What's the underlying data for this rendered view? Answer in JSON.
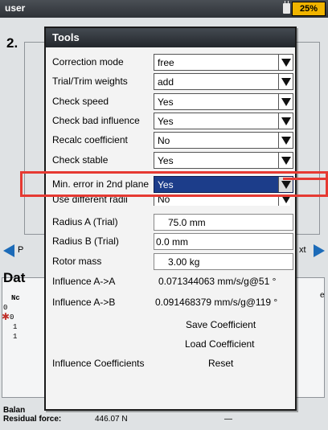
{
  "topbar": {
    "user": "user",
    "battery": "25%"
  },
  "background": {
    "title_fragment": "2. ",
    "prev_fragment": "P",
    "next_fragment": "xt",
    "data_fragment": "Dat",
    "rows_fragment": [
      "Nc",
      "0",
      "0",
      "1",
      "1"
    ],
    "edge_fragment": "e",
    "footer": {
      "balance_label": "Balan",
      "residual_label": "Residual force:",
      "residual_value": "446.07 N",
      "dash": "—"
    }
  },
  "dialog": {
    "title": "Tools",
    "fields": [
      {
        "label": "Correction mode",
        "value": "free",
        "type": "select"
      },
      {
        "label": "Trial/Trim weights",
        "value": "add",
        "type": "select"
      },
      {
        "label": "Check speed",
        "value": "Yes",
        "type": "select"
      },
      {
        "label": "Check bad influence",
        "value": "Yes",
        "type": "select"
      },
      {
        "label": "Recalc coefficient",
        "value": "No",
        "type": "select"
      },
      {
        "label": "Check stable",
        "value": "Yes",
        "type": "select"
      },
      {
        "label": "Min. error in 2nd plane",
        "value": "Yes",
        "type": "select",
        "highlighted": true
      },
      {
        "label": "Use different radii",
        "value": "No",
        "type": "select"
      },
      {
        "label": "Radius A (Trial)",
        "value": "75.0 mm",
        "type": "number"
      },
      {
        "label": "Radius B (Trial)",
        "value": "0.0 mm",
        "type": "number"
      },
      {
        "label": "Rotor mass",
        "value": "3.00 kg",
        "type": "number"
      }
    ],
    "influence": [
      {
        "label": "Influence A->A",
        "value": "0.071344063 mm/s/g@51 °"
      },
      {
        "label": "Influence A->B",
        "value": "0.091468379 mm/s/g@119 °"
      }
    ],
    "save_label": "Save Coefficient",
    "load_label": "Load Coefficient",
    "coefficients_label": "Influence Coefficients",
    "reset_label": "Reset"
  },
  "colors": {
    "highlight": "#1c3d8a",
    "annotation": "#e63a32",
    "nav_arrow": "#1c6bb8",
    "battery": "#f0b400"
  }
}
